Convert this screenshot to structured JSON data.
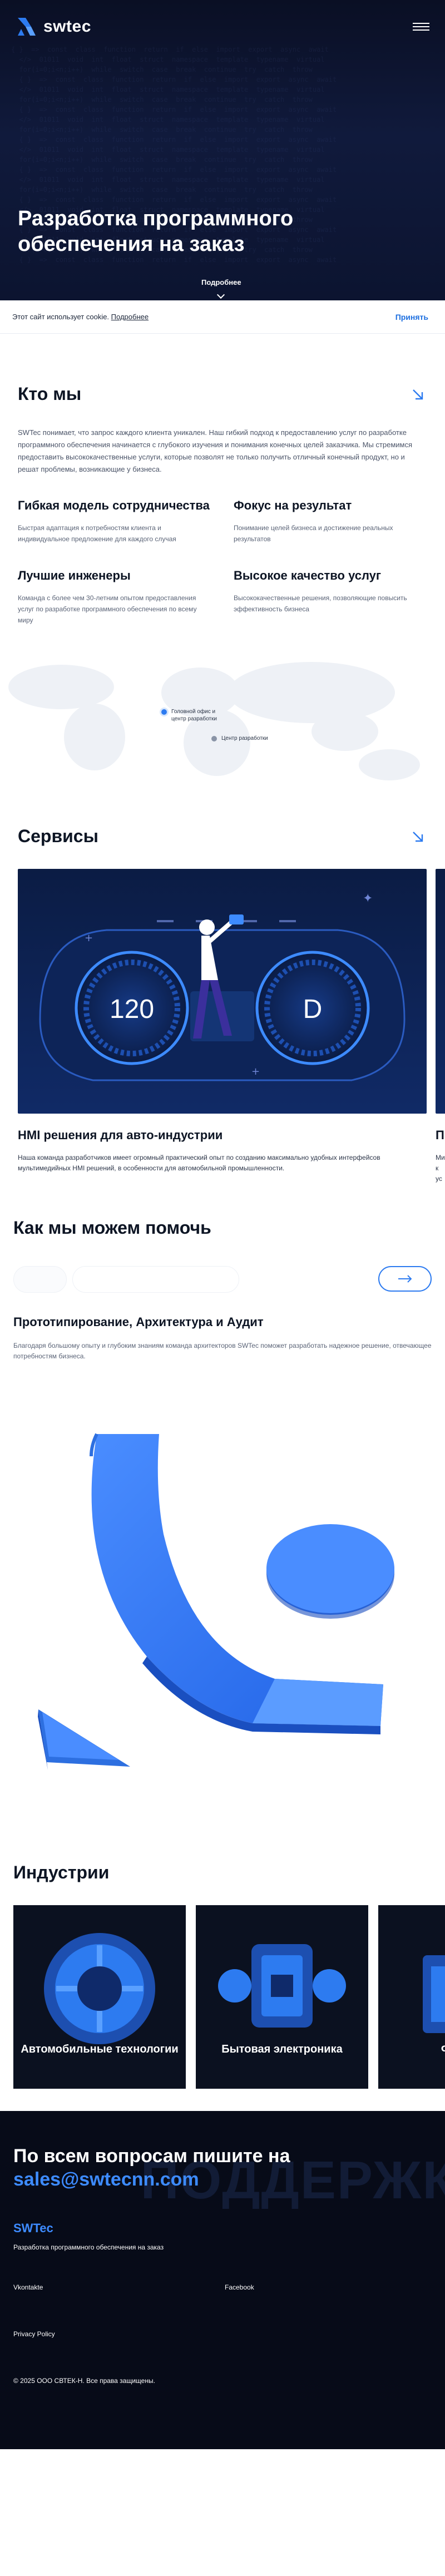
{
  "header": {
    "logo_text": "swtec",
    "menu_icon": "hamburger-icon"
  },
  "hero": {
    "title": "Разработка программного обеспечения на заказ",
    "more_label": "Подробнее",
    "scroll_icon": "chevron-down-icon"
  },
  "cookie": {
    "text": "Этот сайт использует cookie.",
    "link_label": "Подробнее",
    "accept_label": "Принять"
  },
  "about": {
    "heading": "Кто мы",
    "arrow_icon": "arrow-down-right-icon",
    "paragraph": "SWTec понимает, что запрос каждого клиента уникален. Наш гибкий подход к предоставлению услуг по разработке программного обеспечения начинается с глубокого изучения и понимания конечных целей заказчика. Мы стремимся предоставить высококачественные услуги, которые позволят не только получить отличный конечный продукт, но и решат проблемы, возникающие у бизнеса.",
    "features": [
      {
        "title": "Гибкая модель сотрудничества",
        "desc": "Быстрая адаптация к потребностям клиента и индивидуальное предложение для каждого случая"
      },
      {
        "title": "Фокус на результат",
        "desc": "Понимание целей бизнеса и достижение реальных результатов"
      },
      {
        "title": "Лучшие инженеры",
        "desc": "Команда с более чем 30-летним опытом предоставления услуг по разработке программного обеспечения по всему миру"
      },
      {
        "title": "Высокое качество услуг",
        "desc": "Высококачественные решения, позволяющие повысить эффективность бизнеса"
      }
    ]
  },
  "map": {
    "legend": [
      {
        "label": "Головной офис и центр разработки"
      },
      {
        "label": "Центр разработки"
      }
    ]
  },
  "services": {
    "heading": "Сервисы",
    "arrow_icon": "arrow-down-right-icon",
    "cards": [
      {
        "title": "HMI решения для авто-индустрии",
        "desc": "Наша команда разработчиков имеет огромный практический опыт по созданию максимально удобных интерфейсов мультимедийных HMI решений, в особенности для автомобильной промышленности.",
        "speed": "120",
        "gear": "D"
      },
      {
        "title": "П",
        "desc": "Ми\nк\nус"
      }
    ]
  },
  "help": {
    "heading": "Как мы можем помочь",
    "tabs": [
      "",
      ""
    ],
    "next_icon": "arrow-right-icon",
    "title": "Прототипирование, Архитектура и Аудит",
    "desc": "Благодаря большому опыту и глубоким знаниям команда архитекторов SWTec поможет разработать надежное решение, отвечающее потребностям бизнеса."
  },
  "industries": {
    "heading": "Индустрии",
    "items": [
      {
        "label": "Автомобильные технологии"
      },
      {
        "label": "Бытовая электроника"
      },
      {
        "label": "Ф"
      }
    ]
  },
  "footer": {
    "contact_line": "По всем вопросам пишите на",
    "email": "sales@swtecnn.com",
    "bg_word": "ПОДДЕРЖК",
    "brand": "SWTec",
    "tagline": "Разработка программного обеспечения на заказ",
    "links": [
      "Vkontakte",
      "Facebook",
      "Privacy Policy"
    ],
    "copyright": "© 2025 ООО СВТЕК-Н. Все права защищены."
  },
  "colors": {
    "accent": "#2d7bf0",
    "email": "#3d8bff",
    "hero_bg": "#0a0f24",
    "footer_bg": "#070b18"
  }
}
